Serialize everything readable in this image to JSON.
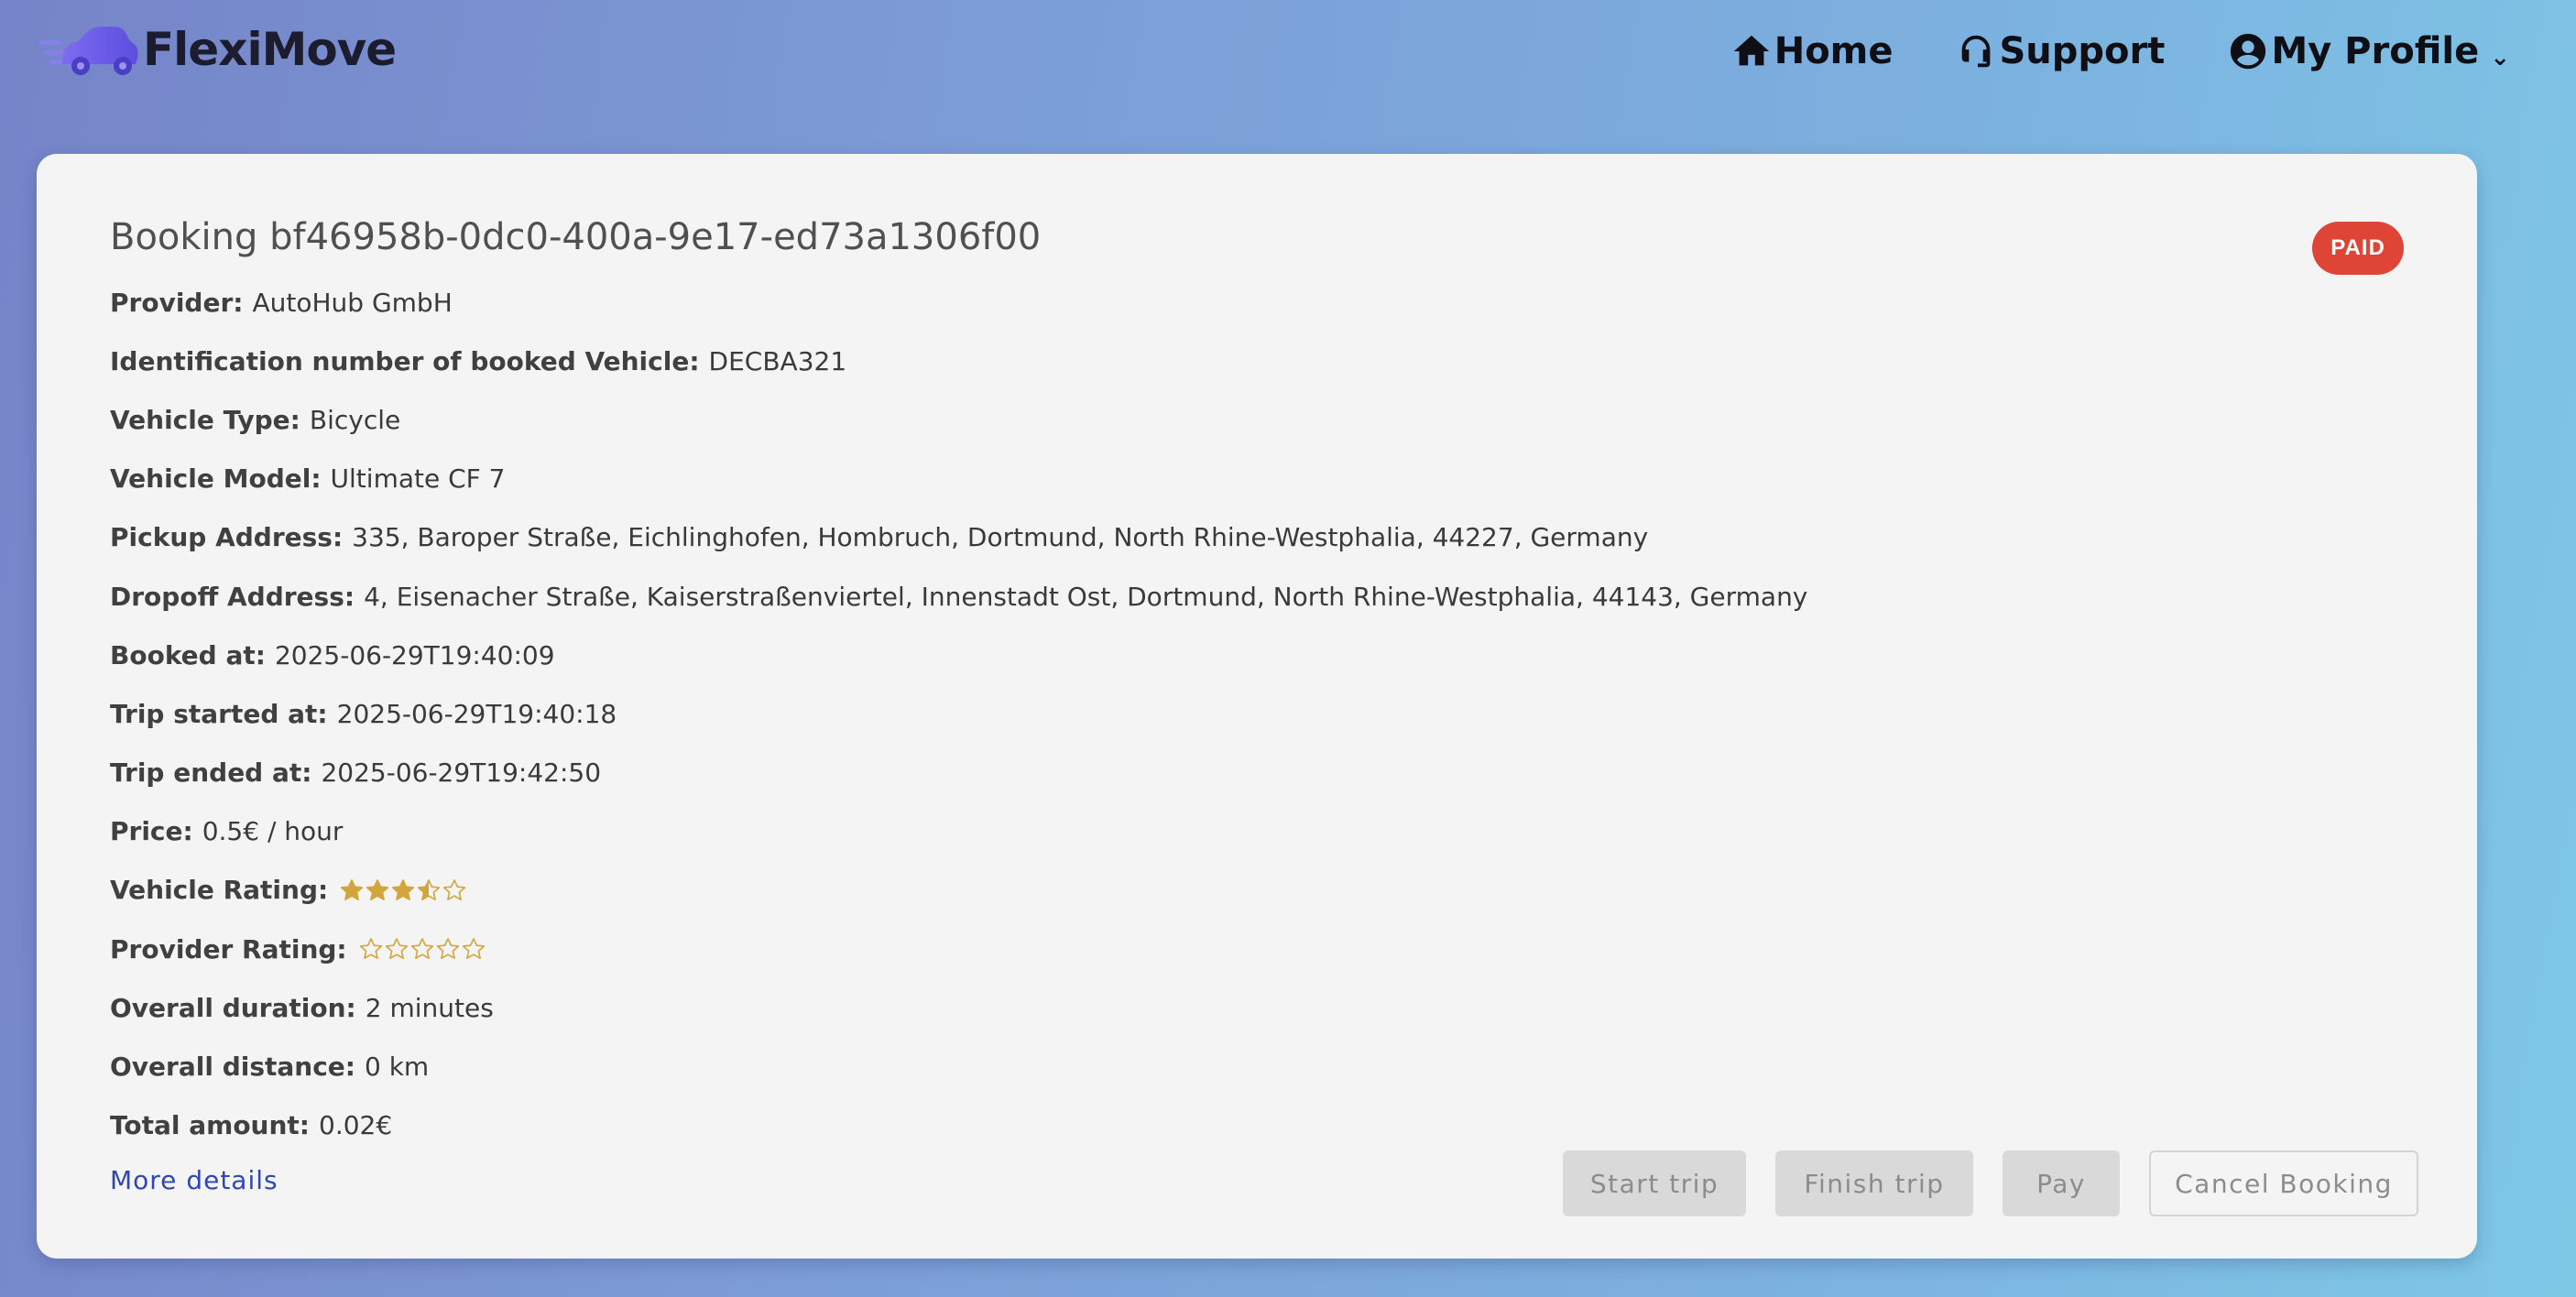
{
  "brand": {
    "name": "FlexiMove"
  },
  "nav": {
    "home": "Home",
    "support": "Support",
    "profile": "My Profile",
    "profile_chevron": "⌄"
  },
  "booking": {
    "title": "Booking bf46958b-0dc0-400a-9e17-ed73a1306f00",
    "status": "PAID",
    "fields": [
      {
        "label": "Provider:",
        "value": "AutoHub GmbH"
      },
      {
        "label": "Identification number of booked Vehicle:",
        "value": "DECBA321"
      },
      {
        "label": "Vehicle Type:",
        "value": "Bicycle"
      },
      {
        "label": "Vehicle Model:",
        "value": "Ultimate CF 7"
      },
      {
        "label": "Pickup Address:",
        "value": "335, Baroper Straße, Eichlinghofen, Hombruch, Dortmund, North Rhine-Westphalia, 44227, Germany"
      },
      {
        "label": "Dropoff Address:",
        "value": "4, Eisenacher Straße, Kaiserstraßenviertel, Innenstadt Ost, Dortmund, North Rhine-Westphalia, 44143, Germany"
      },
      {
        "label": "Booked at:",
        "value": "2025-06-29T19:40:09"
      },
      {
        "label": "Trip started at:",
        "value": "2025-06-29T19:40:18"
      },
      {
        "label": "Trip ended at:",
        "value": "2025-06-29T19:42:50"
      },
      {
        "label": "Price:",
        "value": "0.5€ / hour"
      }
    ],
    "vehicle_rating": {
      "label": "Vehicle Rating:",
      "value": 3.5,
      "max": 5
    },
    "provider_rating": {
      "label": "Provider Rating:",
      "value": 0,
      "max": 5
    },
    "summary": [
      {
        "label": "Overall duration:",
        "value": "2 minutes"
      },
      {
        "label": "Overall distance:",
        "value": "0 km"
      },
      {
        "label": "Total amount:",
        "value": "0.02€"
      }
    ],
    "more_details": "More details",
    "actions": {
      "start": "Start trip",
      "finish": "Finish trip",
      "pay": "Pay",
      "cancel": "Cancel Booking"
    }
  },
  "colors": {
    "badge": "#de4537",
    "star": "#d4a53a",
    "link": "#2f46b3",
    "logo": "#6c5ce7"
  },
  "icons": {
    "home": "home-icon",
    "support": "headset-icon",
    "profile": "account-circle-icon",
    "logo": "car-logo-icon",
    "star_full": "star-filled-icon",
    "star_half": "star-half-icon",
    "star_empty": "star-outline-icon"
  }
}
